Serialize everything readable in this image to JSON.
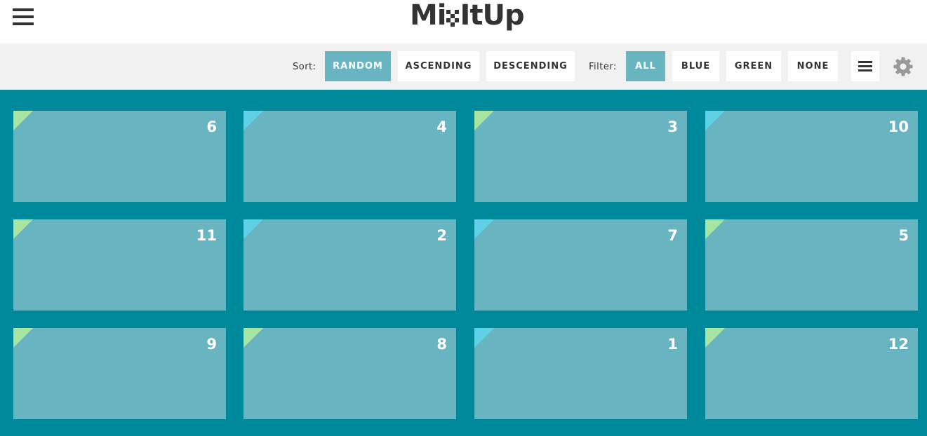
{
  "header": {
    "logo_text_left": "Mi",
    "logo_text_right": "ItUp",
    "menu_icon": "hamburger-icon"
  },
  "controls": {
    "sort_label": "Sort:",
    "sort_buttons": [
      "RANDOM",
      "ASCENDING",
      "DESCENDING"
    ],
    "sort_active": "RANDOM",
    "filter_label": "Filter:",
    "filter_buttons": [
      "ALL",
      "BLUE",
      "GREEN",
      "NONE"
    ],
    "filter_active": "ALL",
    "layout_icon": "list-layout-icon",
    "settings_icon": "gear-icon"
  },
  "colors": {
    "accent": "#68b5c1",
    "grid_background": "#00899b",
    "green_marker": "#a7e3a1",
    "blue_marker": "#5fd0e6"
  },
  "cards": [
    {
      "number": "6",
      "color": "green"
    },
    {
      "number": "4",
      "color": "blue"
    },
    {
      "number": "3",
      "color": "green"
    },
    {
      "number": "10",
      "color": "blue"
    },
    {
      "number": "11",
      "color": "green"
    },
    {
      "number": "2",
      "color": "blue"
    },
    {
      "number": "7",
      "color": "blue"
    },
    {
      "number": "5",
      "color": "green"
    },
    {
      "number": "9",
      "color": "green"
    },
    {
      "number": "8",
      "color": "green"
    },
    {
      "number": "1",
      "color": "blue"
    },
    {
      "number": "12",
      "color": "green"
    }
  ]
}
